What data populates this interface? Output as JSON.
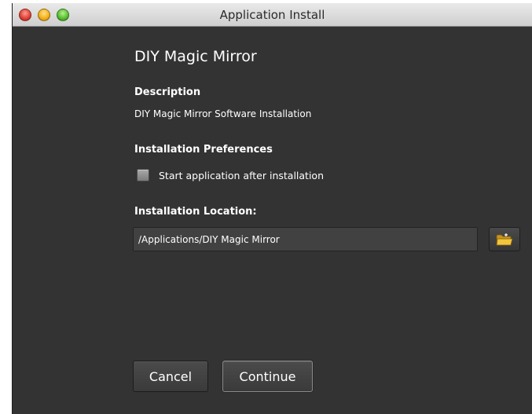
{
  "window": {
    "title": "Application Install"
  },
  "app": {
    "name": "DIY Magic Mirror"
  },
  "description": {
    "label": "Description",
    "text": "DIY Magic Mirror Software Installation"
  },
  "preferences": {
    "label": "Installation Preferences",
    "start_after_install_label": "Start application after installation",
    "start_after_install_checked": false
  },
  "location": {
    "label": "Installation Location:",
    "value": "/Applications/DIY Magic Mirror",
    "browse_icon": "folder-icon"
  },
  "buttons": {
    "cancel": "Cancel",
    "continue": "Continue"
  },
  "colors": {
    "window_background": "#333333",
    "titlebar": "#dcdcdc",
    "close": "#e0443a",
    "minimize": "#f4b21c",
    "zoom": "#5cc034",
    "folder": "#f2c53d"
  }
}
